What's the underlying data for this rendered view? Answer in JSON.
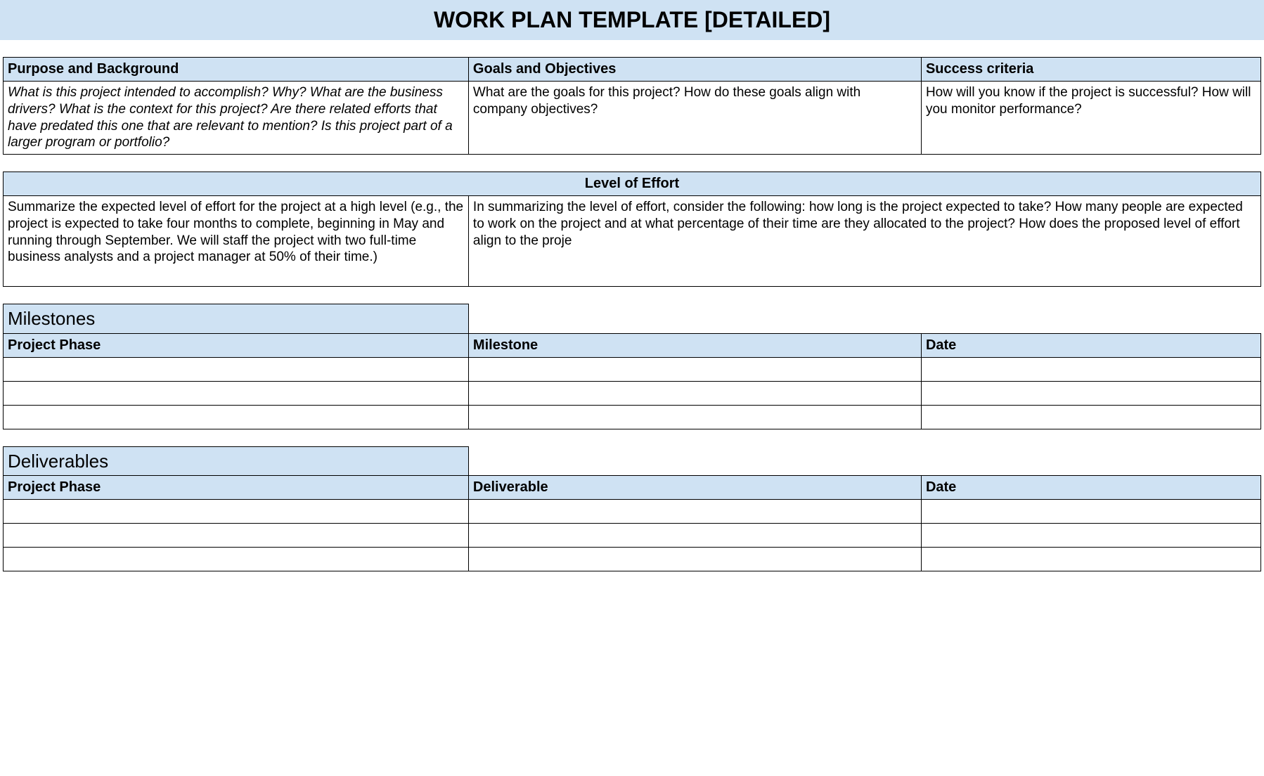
{
  "title": "WORK PLAN TEMPLATE [DETAILED]",
  "top": {
    "purpose": {
      "header": "Purpose and Background",
      "body": "What is this project intended to accomplish? Why? What are the business drivers? What is the context for this project? Are there related efforts that have predated this one that are relevant to mention? Is this project part of a larger program or portfolio?"
    },
    "goals": {
      "header": "Goals and Objectives",
      "body": "What are the goals for this project? How do these goals align with company objectives?"
    },
    "success": {
      "header": "Success criteria",
      "body": "How will you know if the project is successful? How will you monitor performance?"
    }
  },
  "effort": {
    "header": "Level of Effort",
    "left": "Summarize the expected level of effort for the project at a high level (e.g., the project is expected to take four months to complete, beginning in May and running through September. We will staff the project with two full-time business analysts and a project manager at 50% of their time.)",
    "right": "In summarizing the level of effort, consider the following: how long is the project expected to take? How many people are expected to work on the project and at what percentage of their time are they allocated to the project? How does the proposed level of effort align to the proje"
  },
  "milestones": {
    "title": "Milestones",
    "cols": {
      "phase": "Project Phase",
      "milestone": "Milestone",
      "date": "Date"
    }
  },
  "deliverables": {
    "title": "Deliverables",
    "cols": {
      "phase": "Project Phase",
      "deliverable": "Deliverable",
      "date": "Date"
    }
  }
}
